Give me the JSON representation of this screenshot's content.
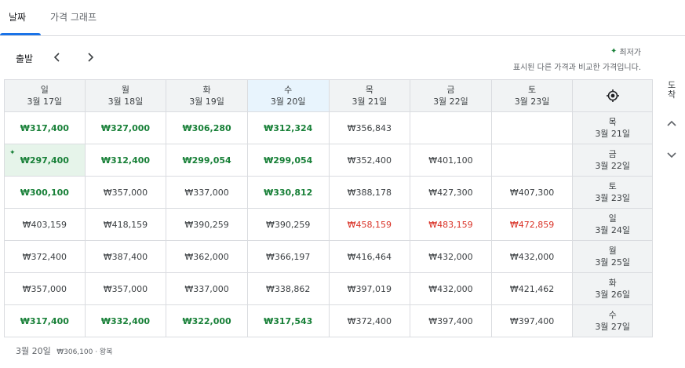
{
  "tabs": [
    {
      "label": "날짜",
      "active": true
    },
    {
      "label": "가격 그래프",
      "active": false
    }
  ],
  "departure": {
    "label": "출발"
  },
  "legend": {
    "title": "최저가",
    "subtitle": "표시된 다른 가격과 비교한 가격입니다."
  },
  "arrival_label": "도착",
  "columns": [
    {
      "day": "일",
      "date": "3월 17일"
    },
    {
      "day": "월",
      "date": "3월 18일"
    },
    {
      "day": "화",
      "date": "3월 19일"
    },
    {
      "day": "수",
      "date": "3월 20일",
      "selected": true
    },
    {
      "day": "목",
      "date": "3월 21일"
    },
    {
      "day": "금",
      "date": "3월 22일"
    },
    {
      "day": "토",
      "date": "3월 23일"
    }
  ],
  "rows": [
    {
      "day": "목",
      "date": "3월 21일",
      "prices": [
        {
          "v": "₩317,400",
          "t": "low"
        },
        {
          "v": "₩327,000",
          "t": "low"
        },
        {
          "v": "₩306,280",
          "t": "low"
        },
        {
          "v": "₩312,324",
          "t": "low"
        },
        {
          "v": "₩356,843",
          "t": "normal"
        },
        {
          "v": "",
          "t": "empty"
        },
        {
          "v": "",
          "t": "empty"
        }
      ]
    },
    {
      "day": "금",
      "date": "3월 22일",
      "prices": [
        {
          "v": "₩297,400",
          "t": "low",
          "cheapest": true
        },
        {
          "v": "₩312,400",
          "t": "low"
        },
        {
          "v": "₩299,054",
          "t": "low"
        },
        {
          "v": "₩299,054",
          "t": "low"
        },
        {
          "v": "₩352,400",
          "t": "normal"
        },
        {
          "v": "₩401,100",
          "t": "normal"
        },
        {
          "v": "",
          "t": "empty"
        }
      ]
    },
    {
      "day": "토",
      "date": "3월 23일",
      "prices": [
        {
          "v": "₩300,100",
          "t": "low"
        },
        {
          "v": "₩357,000",
          "t": "normal"
        },
        {
          "v": "₩337,000",
          "t": "normal"
        },
        {
          "v": "₩330,812",
          "t": "low"
        },
        {
          "v": "₩388,178",
          "t": "normal"
        },
        {
          "v": "₩427,300",
          "t": "normal"
        },
        {
          "v": "₩407,300",
          "t": "normal"
        }
      ]
    },
    {
      "day": "일",
      "date": "3월 24일",
      "prices": [
        {
          "v": "₩403,159",
          "t": "normal"
        },
        {
          "v": "₩418,159",
          "t": "normal"
        },
        {
          "v": "₩390,259",
          "t": "normal"
        },
        {
          "v": "₩390,259",
          "t": "normal"
        },
        {
          "v": "₩458,159",
          "t": "high"
        },
        {
          "v": "₩483,159",
          "t": "high"
        },
        {
          "v": "₩472,859",
          "t": "high"
        }
      ]
    },
    {
      "day": "월",
      "date": "3월 25일",
      "prices": [
        {
          "v": "₩372,400",
          "t": "normal"
        },
        {
          "v": "₩387,400",
          "t": "normal"
        },
        {
          "v": "₩362,000",
          "t": "normal"
        },
        {
          "v": "₩366,197",
          "t": "normal"
        },
        {
          "v": "₩416,464",
          "t": "normal"
        },
        {
          "v": "₩432,000",
          "t": "normal"
        },
        {
          "v": "₩432,000",
          "t": "normal"
        }
      ]
    },
    {
      "day": "화",
      "date": "3월 26일",
      "prices": [
        {
          "v": "₩357,000",
          "t": "normal"
        },
        {
          "v": "₩357,000",
          "t": "normal"
        },
        {
          "v": "₩337,000",
          "t": "normal"
        },
        {
          "v": "₩338,862",
          "t": "normal"
        },
        {
          "v": "₩397,019",
          "t": "normal"
        },
        {
          "v": "₩432,000",
          "t": "normal"
        },
        {
          "v": "₩421,462",
          "t": "normal"
        }
      ]
    },
    {
      "day": "수",
      "date": "3월 27일",
      "prices": [
        {
          "v": "₩317,400",
          "t": "low"
        },
        {
          "v": "₩332,400",
          "t": "low"
        },
        {
          "v": "₩322,000",
          "t": "low"
        },
        {
          "v": "₩317,543",
          "t": "low"
        },
        {
          "v": "₩372,400",
          "t": "normal"
        },
        {
          "v": "₩397,400",
          "t": "normal"
        },
        {
          "v": "₩397,400",
          "t": "normal"
        }
      ]
    }
  ],
  "footer": {
    "date": "3월 20일",
    "price": "₩306,100 · 왕복"
  },
  "icons": {
    "prev": "chevron-left-icon",
    "next": "chevron-right-icon",
    "locate": "crosshair-icon",
    "up": "chevron-up-icon",
    "down": "chevron-down-icon",
    "spark": "sparkle-icon"
  },
  "colors": {
    "low": "#188038",
    "high": "#d93025",
    "accent": "#1a73e8",
    "header_bg": "#f1f3f4",
    "selected_bg": "#e8f4fd",
    "cheapest_bg": "#e6f4ea"
  }
}
